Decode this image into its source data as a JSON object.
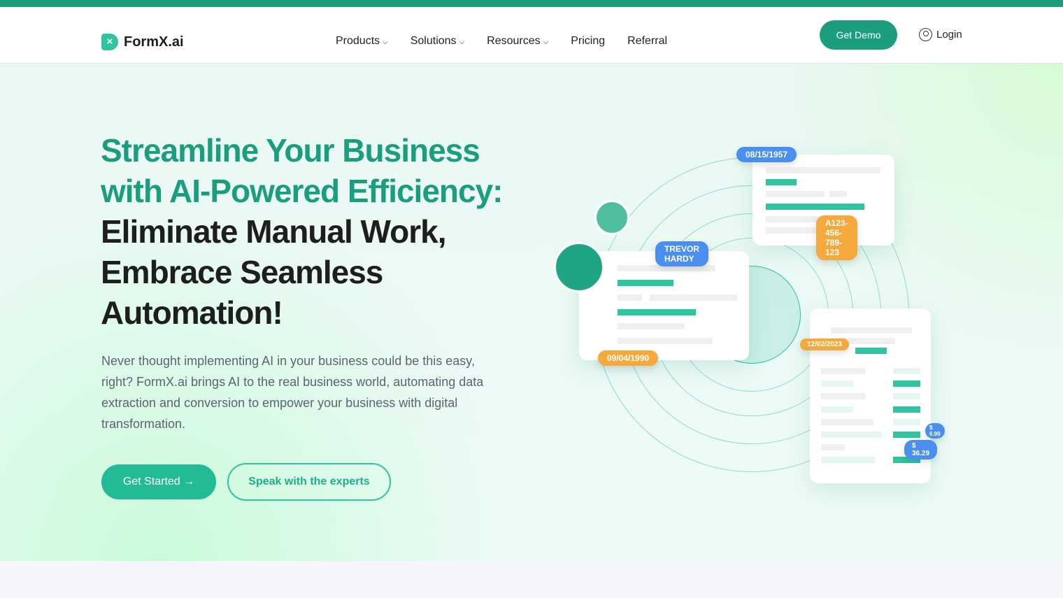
{
  "brand": {
    "name": "FormX.ai",
    "accent": "#1a9e7e"
  },
  "nav": {
    "items": [
      {
        "label": "Products",
        "dropdown": true
      },
      {
        "label": "Solutions",
        "dropdown": true
      },
      {
        "label": "Resources",
        "dropdown": true
      },
      {
        "label": "Pricing"
      },
      {
        "label": "Referral"
      }
    ],
    "demo": "Get Demo",
    "login": "Login"
  },
  "hero": {
    "title_green": "Streamline Your Business with AI-Powered Efficiency:",
    "title_dark": " Eliminate Manual Work, Embrace Seamless Automation!",
    "description": "Never thought implementing AI in your business could be this easy, right? FormX.ai brings AI to the real business world, automating data extraction and conversion to empower your business with digital transformation.",
    "primary_cta": "Get Started →",
    "secondary_cta": "Speak with the experts"
  },
  "illustration": {
    "tags": {
      "dob1": "08/15/1957",
      "id": "A123-456-789-123",
      "name": "TREVOR HARDY",
      "dob2": "09/04/1990",
      "date": "12/02/2023",
      "price1": "$ 6.99",
      "price2": "$ 36.29"
    }
  }
}
